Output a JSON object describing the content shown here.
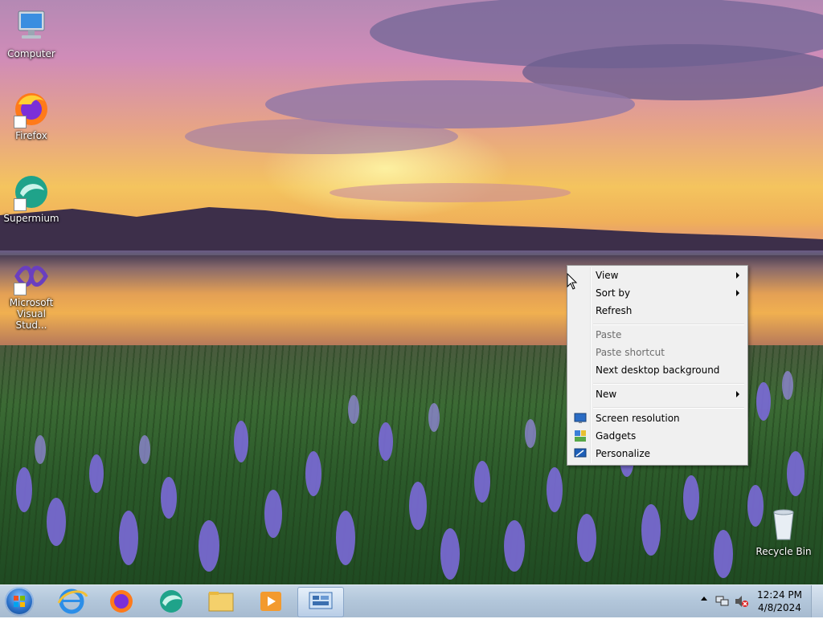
{
  "desktop": {
    "icons": [
      {
        "label": "Computer",
        "icon": "computer-icon"
      },
      {
        "label": "Firefox",
        "icon": "firefox-icon"
      },
      {
        "label": "Supermium",
        "icon": "supermium-icon"
      },
      {
        "label": "Microsoft Visual Stud...",
        "icon": "visual-studio-icon"
      },
      {
        "label": "Recycle Bin",
        "icon": "recycle-bin-icon"
      }
    ]
  },
  "context_menu": {
    "items": [
      {
        "label": "View",
        "submenu": true,
        "enabled": true
      },
      {
        "label": "Sort by",
        "submenu": true,
        "enabled": true
      },
      {
        "label": "Refresh",
        "enabled": true
      },
      {
        "label": "Paste",
        "enabled": false
      },
      {
        "label": "Paste shortcut",
        "enabled": false
      },
      {
        "label": "Next desktop background",
        "enabled": true
      },
      {
        "label": "New",
        "submenu": true,
        "enabled": true
      },
      {
        "label": "Screen resolution",
        "icon": "screen-resolution-icon",
        "enabled": true
      },
      {
        "label": "Gadgets",
        "icon": "gadgets-icon",
        "enabled": true
      },
      {
        "label": "Personalize",
        "icon": "personalize-icon",
        "enabled": true
      }
    ]
  },
  "taskbar": {
    "start": "start-orb-icon",
    "pinned": [
      "internet-explorer-icon",
      "firefox-icon",
      "supermium-icon",
      "file-explorer-icon",
      "media-player-icon",
      "control-panel-icon"
    ],
    "tray_icons": [
      "show-hidden-icons-icon",
      "network-icon",
      "volume-muted-icon"
    ],
    "time": "12:24 PM",
    "date": "4/8/2024"
  },
  "colors": {
    "taskbar": "#b2c6da",
    "menu_bg": "#f0f0f0",
    "disabled_text": "#6d6d6d"
  }
}
